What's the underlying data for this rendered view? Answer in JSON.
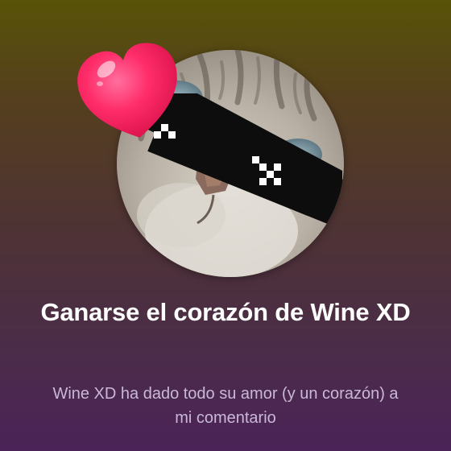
{
  "achievement": {
    "title": "Ganarse el corazón de Wine XD",
    "description": "Wine XD ha dado todo su amor (y un corazón) a mi comentario",
    "avatar_icon": "cat-with-pixel-sunglasses",
    "badge_icon": "heart-icon"
  },
  "colors": {
    "background_top": "#585308",
    "background_bottom": "#4b2358",
    "title": "#ffffff",
    "description": "#c9b8d6",
    "heart": "#ff2d6a"
  }
}
